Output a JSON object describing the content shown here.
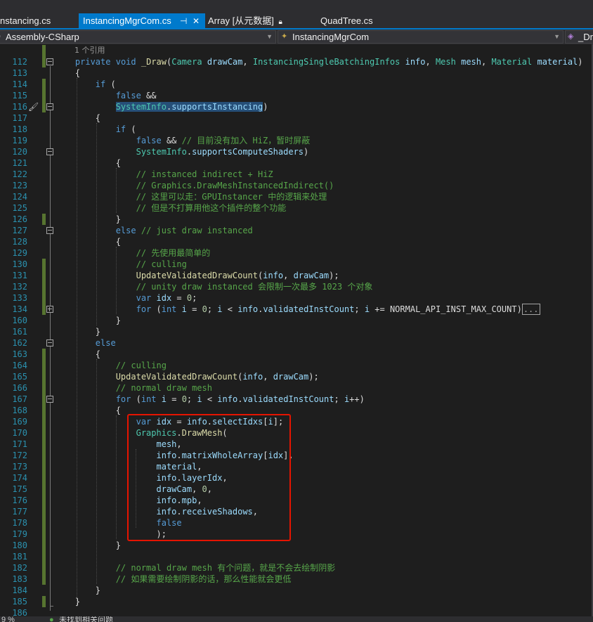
{
  "tabs": [
    {
      "label": "nstancing.cs",
      "active": false
    },
    {
      "label": "InstancingMgrCom.cs",
      "active": true,
      "pin_icon": "pin-icon",
      "close_icon": "close-icon"
    },
    {
      "label": "Array [从元数据]",
      "active": false,
      "lock_icon": "lock-icon"
    },
    {
      "label": "QuadTree.cs",
      "active": false
    }
  ],
  "navbar": {
    "project": "Assembly-CSharp",
    "class_name": "InstancingMgrCom",
    "member_name": "_Dra"
  },
  "codelens": "1 个引用",
  "lines": [
    "112",
    "113",
    "114",
    "115",
    "116",
    "117",
    "118",
    "119",
    "120",
    "121",
    "122",
    "123",
    "124",
    "125",
    "126",
    "127",
    "128",
    "129",
    "130",
    "131",
    "132",
    "133",
    "134",
    "160",
    "161",
    "162",
    "163",
    "164",
    "165",
    "166",
    "167",
    "168",
    "169",
    "170",
    "171",
    "172",
    "173",
    "174",
    "175",
    "176",
    "177",
    "178",
    "179",
    "180",
    "181",
    "182",
    "183",
    "184",
    "185",
    "186"
  ],
  "collapsed_ellipsis": "...",
  "status": {
    "items": [
      "9 %",
      "未找到相关问题"
    ]
  },
  "colors": {
    "accent": "#007acc",
    "keyword": "#569cd6",
    "type": "#4ec9b0",
    "comment": "#57a64a",
    "highlight_box": "#e51400"
  }
}
